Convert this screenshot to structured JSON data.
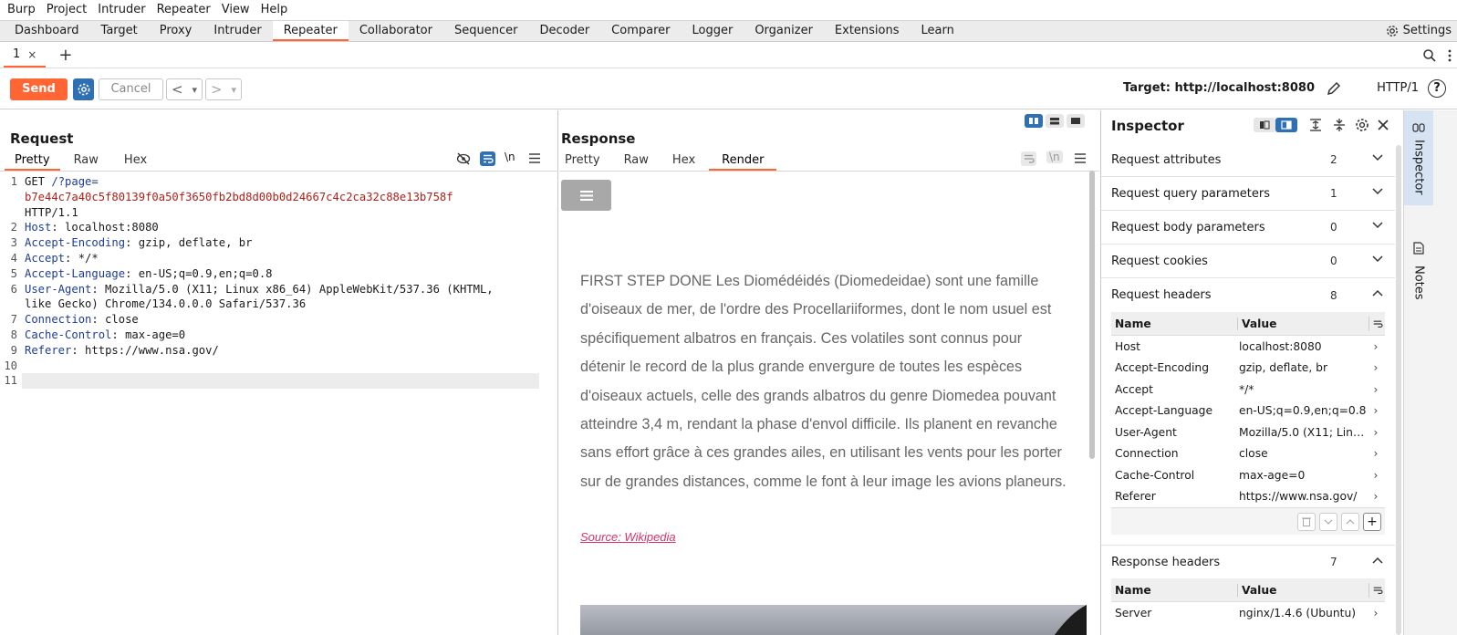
{
  "menu": [
    "Burp",
    "Project",
    "Intruder",
    "Repeater",
    "View",
    "Help"
  ],
  "main_tabs": [
    "Dashboard",
    "Target",
    "Proxy",
    "Intruder",
    "Repeater",
    "Collaborator",
    "Sequencer",
    "Decoder",
    "Comparer",
    "Logger",
    "Organizer",
    "Extensions",
    "Learn"
  ],
  "active_main_tab": "Repeater",
  "settings_label": "Settings",
  "repeater_tab": {
    "label": "1",
    "close": "×",
    "add": "+"
  },
  "toolbar": {
    "send": "Send",
    "cancel": "Cancel",
    "back": "<",
    "forward": ">",
    "dropdown": "▾",
    "target": "Target: http://localhost:8080",
    "http_version": "HTTP/1",
    "help": "?"
  },
  "request": {
    "title": "Request",
    "tabs": [
      "Pretty",
      "Raw",
      "Hex"
    ],
    "active_tab": "Pretty",
    "newline_toggle": "\\n",
    "line_numbers": [
      "1",
      "2",
      "3",
      "4",
      "5",
      "6",
      "7",
      "8",
      "9",
      "10",
      "11"
    ],
    "request_line": {
      "method": "GET",
      "path": "/?page=",
      "hash": "b7e44c7a40c5f80139f0a50f3650fb2bd8d00b0d24667c4c2ca32c88e13b758f",
      "version": "HTTP/1.1"
    },
    "headers": [
      {
        "name": "Host",
        "value": " localhost:8080"
      },
      {
        "name": "Accept-Encoding",
        "value": " gzip, deflate, br"
      },
      {
        "name": "Accept",
        "value": " */*"
      },
      {
        "name": "Accept-Language",
        "value": " en-US;q=0.9,en;q=0.8"
      },
      {
        "name": "User-Agent",
        "value": " Mozilla/5.0 (X11; Linux x86_64) AppleWebKit/537.36 (KHTML,",
        "cont": "like Gecko) Chrome/134.0.0.0 Safari/537.36"
      },
      {
        "name": "Connection",
        "value": " close"
      },
      {
        "name": "Cache-Control",
        "value": " max-age=0"
      },
      {
        "name": "Referer",
        "value": " https://www.nsa.gov/"
      }
    ]
  },
  "response": {
    "title": "Response",
    "tabs": [
      "Pretty",
      "Raw",
      "Hex",
      "Render"
    ],
    "active_tab": "Render",
    "newline_toggle": "\\n",
    "render_text": "FIRST STEP DONE Les Diomédéidés (Diomedeidae) sont une famille d'oiseaux de mer, de l'ordre des Procellariiformes, dont le nom usuel est spécifiquement albatros en français. Ces volatiles sont connus pour détenir le record de la plus grande envergure de toutes les espèces d'oiseaux actuels, celle des grands albatros du genre Diomedea pouvant atteindre 3,4 m, rendant la phase d'envol difficile. Ils planent en revanche sans effort grâce à ces grandes ailes, en utilisant les vents pour les porter sur de grandes distances, comme le font à leur image les avions planeurs.",
    "source_link": "Source: Wikipedia"
  },
  "inspector": {
    "title": "Inspector",
    "sections": [
      {
        "label": "Request attributes",
        "count": "2",
        "expanded": false
      },
      {
        "label": "Request query parameters",
        "count": "1",
        "expanded": false
      },
      {
        "label": "Request body parameters",
        "count": "0",
        "expanded": false
      },
      {
        "label": "Request cookies",
        "count": "0",
        "expanded": false
      },
      {
        "label": "Request headers",
        "count": "8",
        "expanded": true
      },
      {
        "label": "Response headers",
        "count": "7",
        "expanded": true
      }
    ],
    "table_headers": {
      "name": "Name",
      "value": "Value"
    },
    "request_headers": [
      {
        "name": "Host",
        "value": "localhost:8080"
      },
      {
        "name": "Accept-Encoding",
        "value": "gzip, deflate, br"
      },
      {
        "name": "Accept",
        "value": "*/*"
      },
      {
        "name": "Accept-Language",
        "value": "en-US;q=0.9,en;q=0.8"
      },
      {
        "name": "User-Agent",
        "value": "Mozilla/5.0 (X11; Linu..."
      },
      {
        "name": "Connection",
        "value": "close"
      },
      {
        "name": "Cache-Control",
        "value": "max-age=0"
      },
      {
        "name": "Referer",
        "value": "https://www.nsa.gov/"
      }
    ],
    "response_headers": [
      {
        "name": "Server",
        "value": "nginx/1.4.6 (Ubuntu)"
      }
    ]
  },
  "side_tabs": [
    "Inspector",
    "Notes"
  ],
  "colors": {
    "accent": "#ff6633",
    "blue": "#2f6fb3",
    "header_name": "#1d3d96",
    "hash_red": "#b0201a",
    "link": "#d6336c"
  }
}
